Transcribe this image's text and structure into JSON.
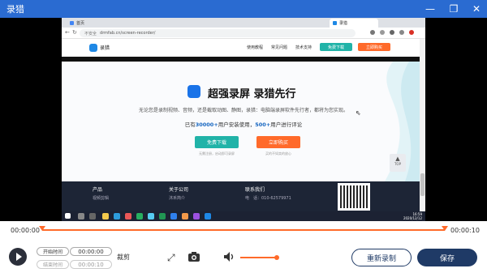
{
  "window": {
    "title": "录猎",
    "minimize": "—",
    "restore": "❐",
    "close": "✕"
  },
  "browser": {
    "tab_inactive": "首页",
    "tab_active": "录猎",
    "security": "不安全",
    "url": "drmfab.cn/screen-recorder/"
  },
  "site": {
    "logo_text": "录猎",
    "nav": [
      "使用教程",
      "常见问题",
      "技术支持"
    ],
    "btn_download": "免费下载",
    "btn_buy": "立即购买"
  },
  "hero": {
    "title": "超强录屏 录猎先行",
    "subtitle": "无论您是录制视频、音频，还是截取动图、静图，录猎：电脑端录屏软件先行者，都将为您实现。",
    "stats_prefix": "已有",
    "stats_users": "30000+",
    "stats_mid": "用户安装使用，",
    "stats_reviews": "500+",
    "stats_suffix": "用户进行评论",
    "cta_download": "免费下载",
    "cta_buy": "立即购买",
    "note_download": "无需注册，启动即可录屏",
    "note_buy": "买的不如卖的放心"
  },
  "footer": {
    "col1_title": "产品",
    "col1_item": "视频剪辑",
    "col2_title": "关于公司",
    "col2_item": "沐禾简介",
    "col3_title": "联系我们",
    "col3_item": "电　话：010-62579971",
    "top_label": "TOP"
  },
  "taskbar": {
    "time": "16:59",
    "date": "2020/12/12"
  },
  "timeline": {
    "start": "00:00:00",
    "end": "00:00:10"
  },
  "controls": {
    "start_label": "开始时间",
    "start_value": "00:00:00",
    "end_label": "结束时间",
    "end_value": "00:00:10",
    "trim_label": "裁剪",
    "rerecord": "重新录制",
    "save": "保存"
  },
  "colors": {
    "titlebar": "#2a6bd1",
    "accent": "#ff6a2a",
    "primary": "#1f3a66"
  }
}
